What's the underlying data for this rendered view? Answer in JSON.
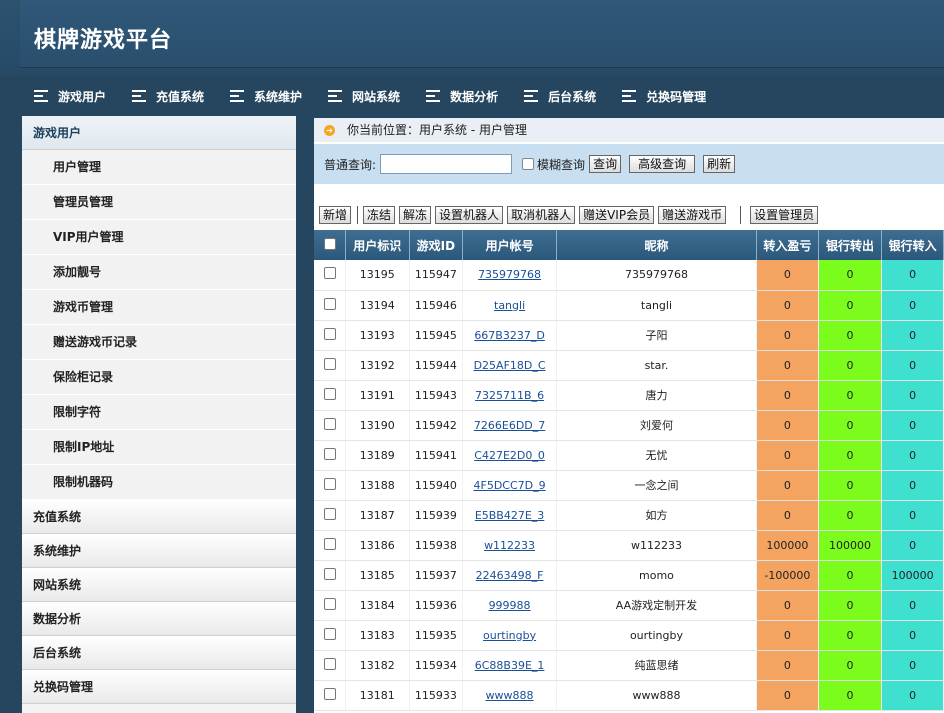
{
  "app": {
    "title": "棋牌游戏平台"
  },
  "topnav": [
    {
      "label": "游戏用户"
    },
    {
      "label": "充值系统"
    },
    {
      "label": "系统维护"
    },
    {
      "label": "网站系统"
    },
    {
      "label": "数据分析"
    },
    {
      "label": "后台系统"
    },
    {
      "label": "兑换码管理"
    }
  ],
  "sidebar": {
    "active_group": "游戏用户",
    "items": [
      "用户管理",
      "管理员管理",
      "VIP用户管理",
      "添加靓号",
      "游戏币管理",
      "赠送游戏币记录",
      "保险柜记录",
      "限制字符",
      "限制IP地址",
      "限制机器码"
    ],
    "groups": [
      "充值系统",
      "系统维护",
      "网站系统",
      "数据分析",
      "后台系统",
      "兑换码管理"
    ]
  },
  "breadcrumb": {
    "text": "你当前位置：用户系统 - 用户管理"
  },
  "search": {
    "label": "普通查询:",
    "value": "",
    "fuzzy_label": "模糊查询",
    "query_btn": "查询",
    "advanced_btn": "高级查询",
    "refresh_btn": "刷新"
  },
  "toolbar": {
    "add": "新增",
    "freeze": "冻结",
    "unfreeze": "解冻",
    "set_robot": "设置机器人",
    "cancel_robot": "取消机器人",
    "gift_vip": "赠送VIP会员",
    "gift_coins": "赠送游戏币",
    "set_admin": "设置管理员"
  },
  "table": {
    "headers": [
      "用户标识",
      "游戏ID",
      "用户帐号",
      "昵称",
      "转入盈亏",
      "银行转出",
      "银行转入"
    ],
    "rows": [
      [
        "13195",
        "115947",
        "735979768",
        "735979768",
        "0",
        "0",
        "0"
      ],
      [
        "13194",
        "115946",
        "tangli",
        "tangli",
        "0",
        "0",
        "0"
      ],
      [
        "13193",
        "115945",
        "667B3237_D",
        "子阳",
        "0",
        "0",
        "0"
      ],
      [
        "13192",
        "115944",
        "D25AF18D_C",
        "star.",
        "0",
        "0",
        "0"
      ],
      [
        "13191",
        "115943",
        "7325711B_6",
        "唐力",
        "0",
        "0",
        "0"
      ],
      [
        "13190",
        "115942",
        "7266E6DD_7",
        "刘爱何",
        "0",
        "0",
        "0"
      ],
      [
        "13189",
        "115941",
        "C427E2D0_0",
        "无忧",
        "0",
        "0",
        "0"
      ],
      [
        "13188",
        "115940",
        "4F5DCC7D_9",
        "一念之间",
        "0",
        "0",
        "0"
      ],
      [
        "13187",
        "115939",
        "E5BB427E_3",
        "如方",
        "0",
        "0",
        "0"
      ],
      [
        "13186",
        "115938",
        "w112233",
        "w112233",
        "100000",
        "100000",
        "0"
      ],
      [
        "13185",
        "115937",
        "22463498_F",
        "momo",
        "-100000",
        "0",
        "100000"
      ],
      [
        "13184",
        "115936",
        "999988",
        "AA游戏定制开发",
        "0",
        "0",
        "0"
      ],
      [
        "13183",
        "115935",
        "ourtingby",
        "ourtingby",
        "0",
        "0",
        "0"
      ],
      [
        "13182",
        "115934",
        "6C88B39E_1",
        "纯蓝思绪",
        "0",
        "0",
        "0"
      ],
      [
        "13181",
        "115933",
        "www888",
        "www888",
        "0",
        "0",
        "0"
      ]
    ]
  },
  "colors": {
    "header_bg": "#2d5270",
    "transfer_in_col": "#f4a460",
    "bank_out_col": "#7cfc1c",
    "bank_in_col": "#40e0d0"
  }
}
